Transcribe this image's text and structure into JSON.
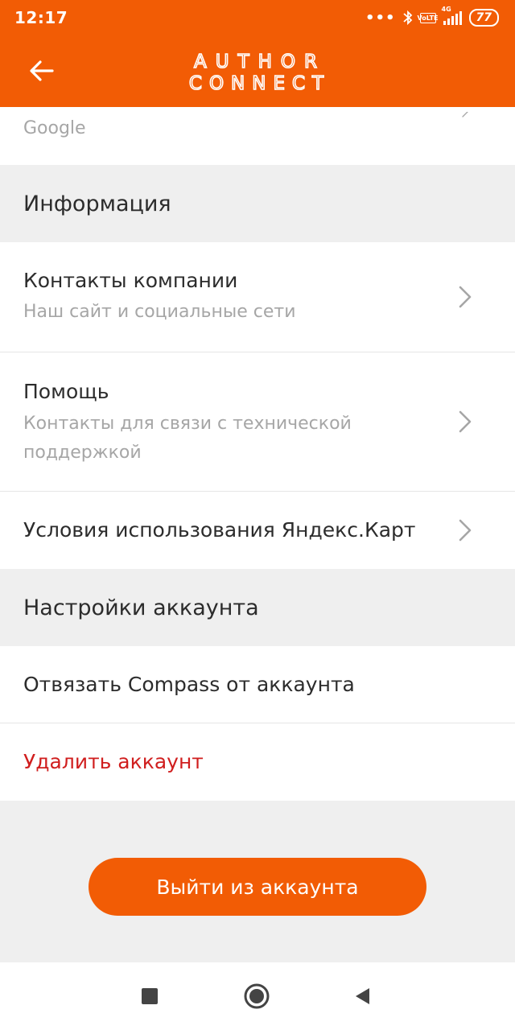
{
  "status_bar": {
    "time": "12:17",
    "more_dots": "•••",
    "bluetooth": "✱",
    "volte_top": "Vo",
    "volte_bottom": "LTE",
    "network": "4G",
    "battery": "77"
  },
  "header": {
    "brand_line1": "AUTHOR",
    "brand_line2": "CONNECT"
  },
  "top_partial": {
    "subtitle": "Google"
  },
  "sections": [
    {
      "title": "Информация"
    },
    {
      "title": "Настройки аккаунта"
    }
  ],
  "info_items": [
    {
      "title": "Контакты компании",
      "subtitle": "Наш сайт и социальные сети"
    },
    {
      "title": "Помощь",
      "subtitle_line1": "Контакты для связи с технической",
      "subtitle_line2": "поддержкой"
    },
    {
      "title": "Условия использования Яндекс.Карт"
    }
  ],
  "account_items": [
    {
      "title": "Отвязать Compass от аккаунта"
    },
    {
      "title": "Удалить аккаунт"
    }
  ],
  "logout_label": "Выйти из аккаунта",
  "colors": {
    "brand_orange": "#f25c05",
    "danger_red": "#d01e1e",
    "background_gray": "#efefef"
  },
  "icons": {
    "back": "arrow-left-icon",
    "chevron": "chevron-right-icon",
    "nav_recent": "square-icon",
    "nav_home": "circle-icon",
    "nav_back": "triangle-back-icon"
  }
}
